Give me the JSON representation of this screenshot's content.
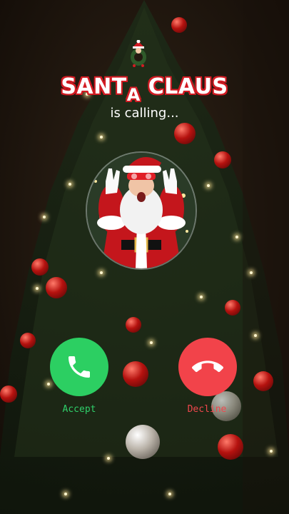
{
  "caller": {
    "name_part1": "SANT",
    "name_part2": "A",
    "name_part3": "CLAUS",
    "status": "is calling..."
  },
  "actions": {
    "accept_label": "Accept",
    "decline_label": "Decline"
  },
  "colors": {
    "accept": "#2ccf62",
    "decline": "#f2434a",
    "title_outline": "#d31b23"
  },
  "icons": {
    "accept": "phone-icon",
    "decline": "hang-up-icon",
    "top": "santa-wreath-icon"
  }
}
